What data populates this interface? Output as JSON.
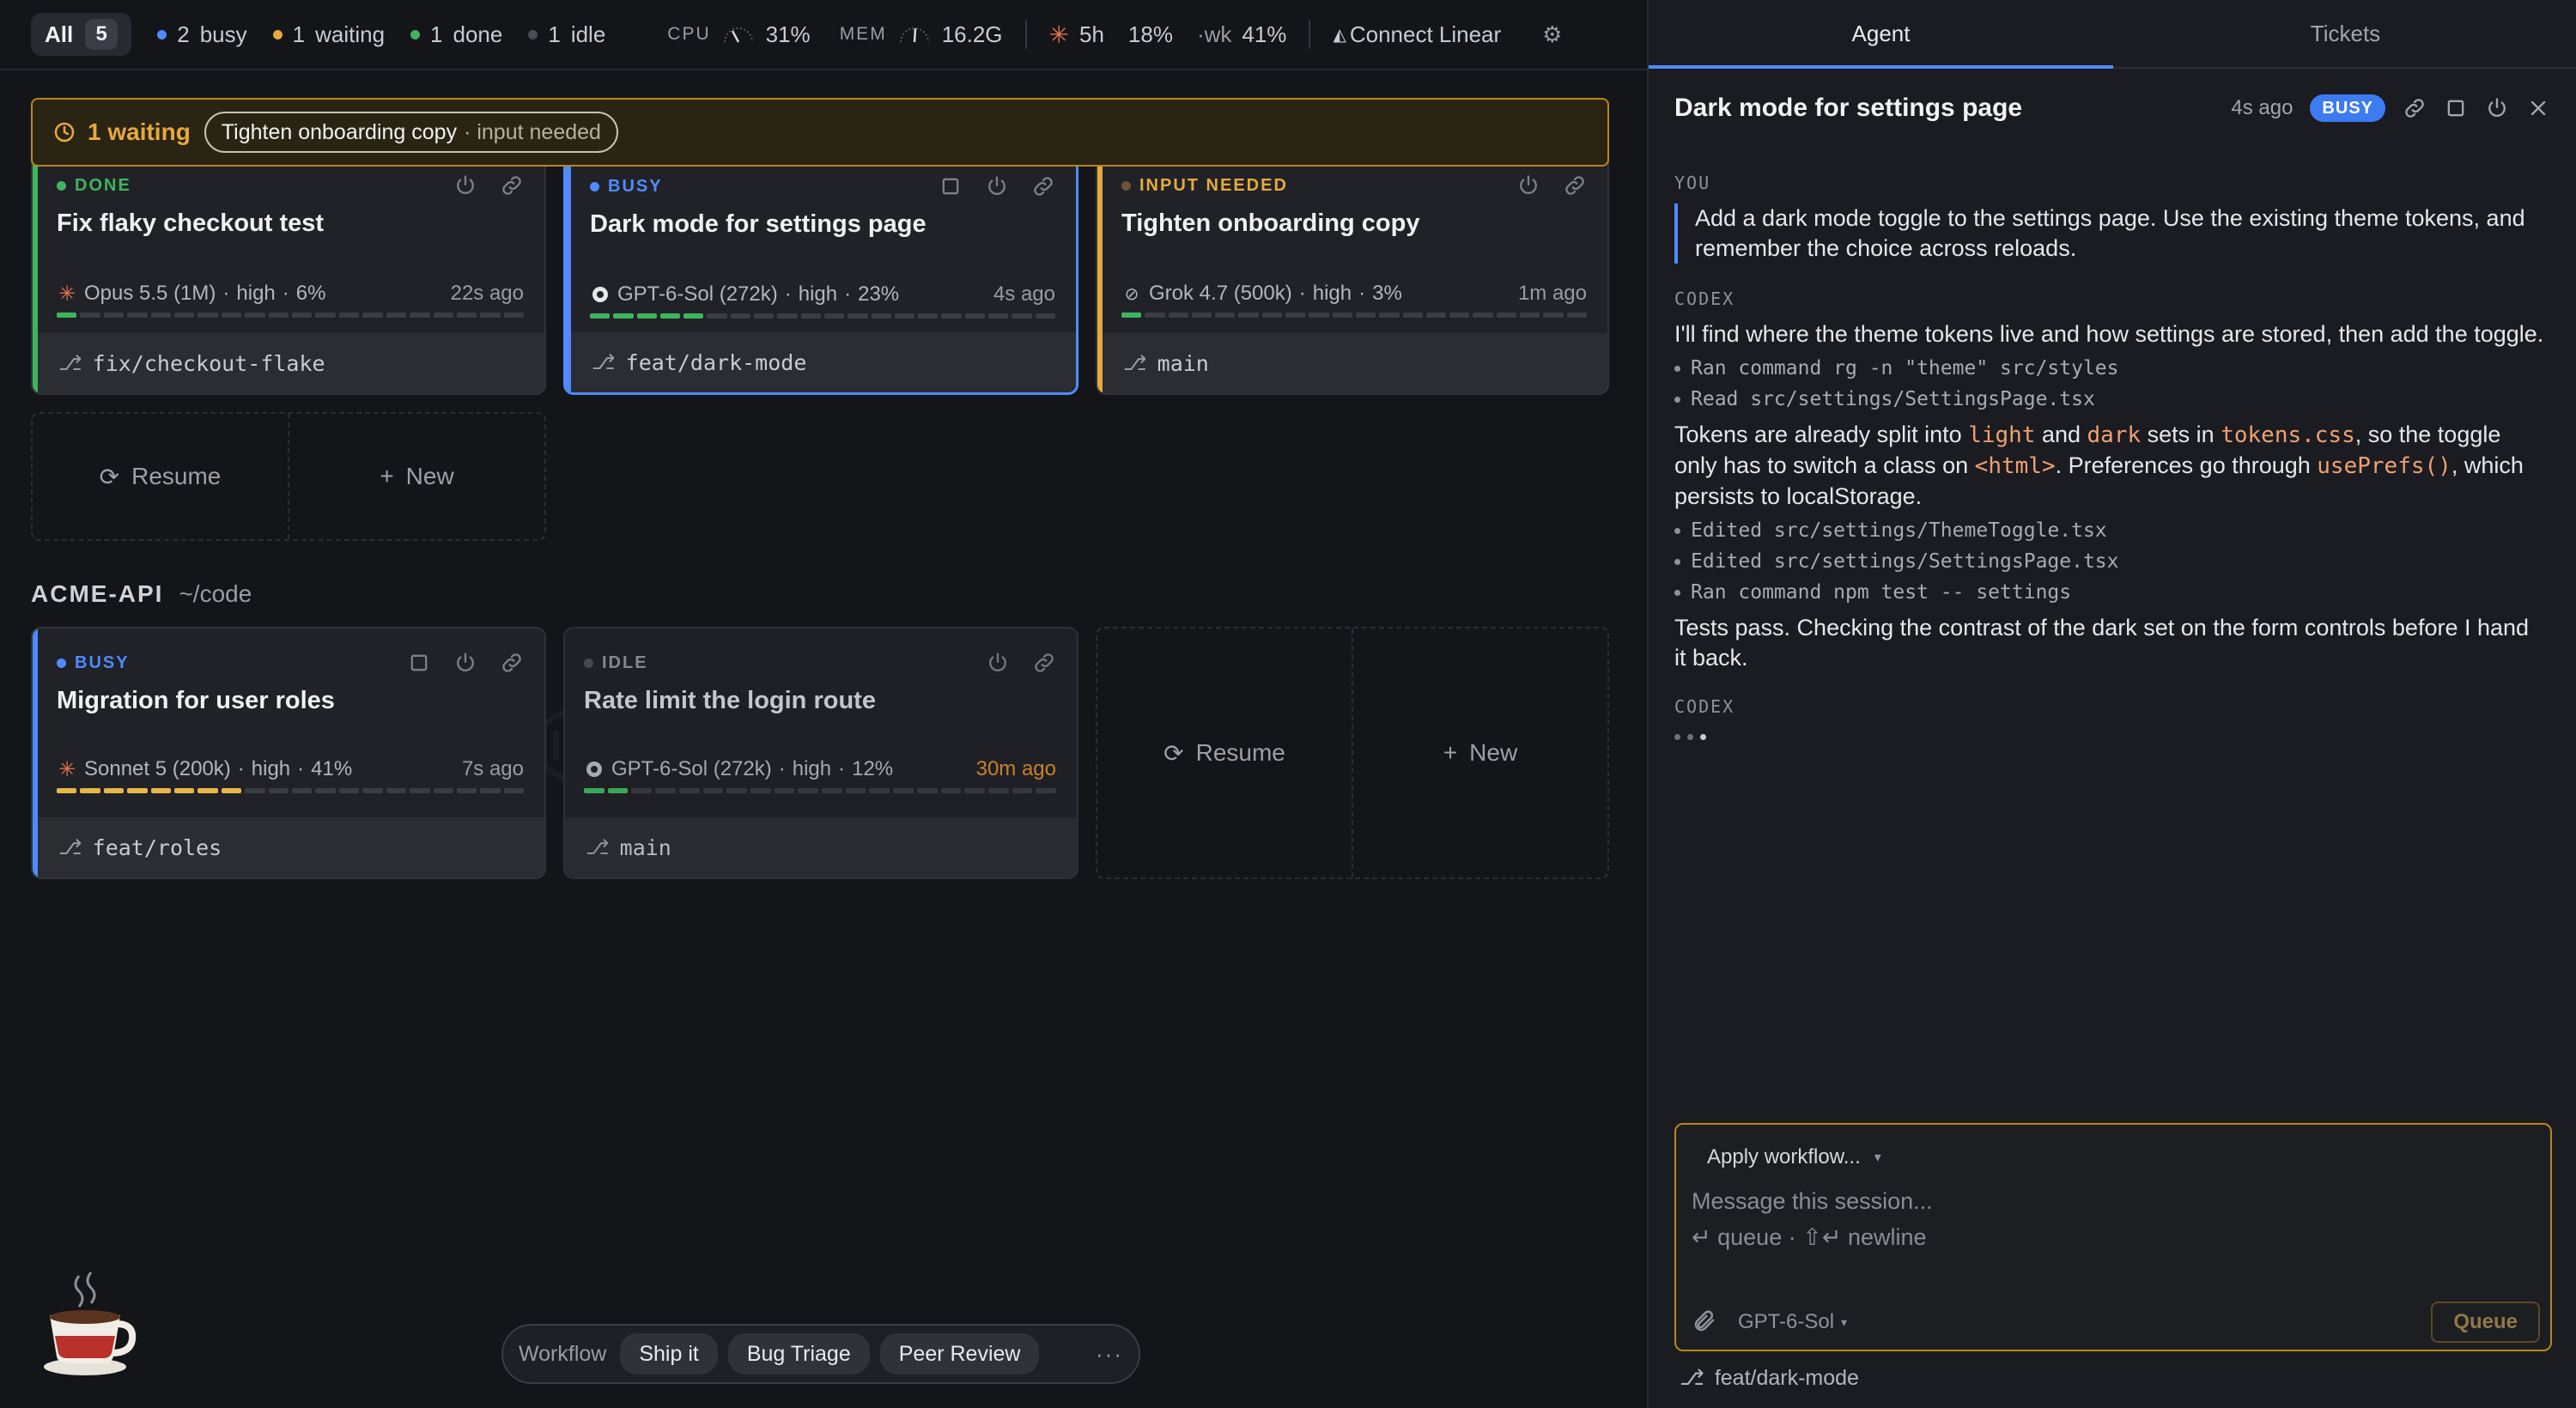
{
  "statusbar": {
    "all_label": "All",
    "all_count": "5",
    "busy_count": "2",
    "busy_label": "busy",
    "waiting_count": "1",
    "waiting_label": "waiting",
    "done_count": "1",
    "done_label": "done",
    "idle_count": "1",
    "idle_label": "idle",
    "cpu_label": "CPU",
    "cpu_value": "31%",
    "mem_label": "MEM",
    "mem_value": "16.2G",
    "usage_5h_label": "5h",
    "usage_5h_value": "18%",
    "usage_wk_label": "·wk",
    "usage_wk_value": "41%",
    "connect_label": "Connect Linear"
  },
  "banner": {
    "text": "1 waiting",
    "chip_title": "Tighten onboarding copy",
    "chip_sub": "· input needed"
  },
  "cards_top": [
    {
      "state": "DONE",
      "title": "Fix flaky checkout test",
      "model": "Opus 5.5 (1M)",
      "effort": "high",
      "pct": "6%",
      "time": "22s ago",
      "branch": "fix/checkout-flake"
    },
    {
      "state": "BUSY",
      "title": "Dark mode for settings page",
      "model": "GPT-6-Sol (272k)",
      "effort": "high",
      "pct": "23%",
      "time": "4s ago",
      "branch": "feat/dark-mode"
    },
    {
      "state": "INPUT NEEDED",
      "title": "Tighten onboarding copy",
      "model": "Grok 4.7 (500k)",
      "effort": "high",
      "pct": "3%",
      "time": "1m ago",
      "branch": "main"
    }
  ],
  "slot_top": {
    "resume": "Resume",
    "new": "New"
  },
  "group": {
    "name": "ACME-API",
    "path": "~/code"
  },
  "cards_bottom": [
    {
      "state": "BUSY",
      "title": "Migration for user roles",
      "model": "Sonnet 5 (200k)",
      "effort": "high",
      "pct": "41%",
      "time": "7s ago",
      "branch": "feat/roles"
    },
    {
      "state": "IDLE",
      "title": "Rate limit the login route",
      "model": "GPT-6-Sol (272k)",
      "effort": "high",
      "pct": "12%",
      "time": "30m ago",
      "branch": "main"
    }
  ],
  "slot_bottom": {
    "resume": "Resume",
    "new": "New"
  },
  "workflow": {
    "label": "Workflow",
    "chips": [
      "Ship it",
      "Bug Triage",
      "Peer Review"
    ],
    "more": "···"
  },
  "panel": {
    "tabs": [
      "Agent",
      "Tickets"
    ],
    "title": "Dark mode for settings page",
    "time": "4s ago",
    "badge": "BUSY",
    "you_label": "YOU",
    "user_msg": "Add a dark mode toggle to the settings page. Use the existing theme tokens, and remember the choice across reloads.",
    "codex_label": "CODEX",
    "reply1": "I'll find where the theme tokens live and how settings are stored, then add the toggle.",
    "steps1": [
      "Ran command rg -n \"theme\" src/styles",
      "Read src/settings/SettingsPage.tsx"
    ],
    "reply2_a": "Tokens are already split into ",
    "reply2_code1": "light",
    "reply2_b": " and ",
    "reply2_code2": "dark",
    "reply2_c": " sets in ",
    "reply2_code3": "tokens.css",
    "reply2_d": ", so the toggle only has to switch a class on ",
    "reply2_code4": "<html>",
    "reply2_e": ". Preferences go through ",
    "reply2_code5": "usePrefs()",
    "reply2_f": ", which persists to localStorage.",
    "steps2": [
      "Edited src/settings/ThemeToggle.tsx",
      "Edited src/settings/SettingsPage.tsx",
      "Ran command npm test -- settings"
    ],
    "reply3": "Tests pass. Checking the contrast of the dark set on the form controls before I hand it back.",
    "codex_label2": "CODEX",
    "composer": {
      "apply_workflow": "Apply workflow...",
      "placeholder": "Message this session...",
      "hint": "↵ queue · ⇧↵ newline",
      "model": "GPT-6-Sol",
      "queue": "Queue"
    },
    "branch": "feat/dark-mode"
  },
  "colors": {
    "busy": "#4f8bff",
    "done": "#3fb45f",
    "waiting": "#e7a93a",
    "idle": "#5c5f66",
    "accent_code": "#f0a070"
  },
  "progress": {
    "card_top_1": 0.06,
    "card_top_2": 0.23,
    "card_top_3": 0.03,
    "card_bottom_1": 0.41,
    "card_bottom_2": 0.12
  }
}
